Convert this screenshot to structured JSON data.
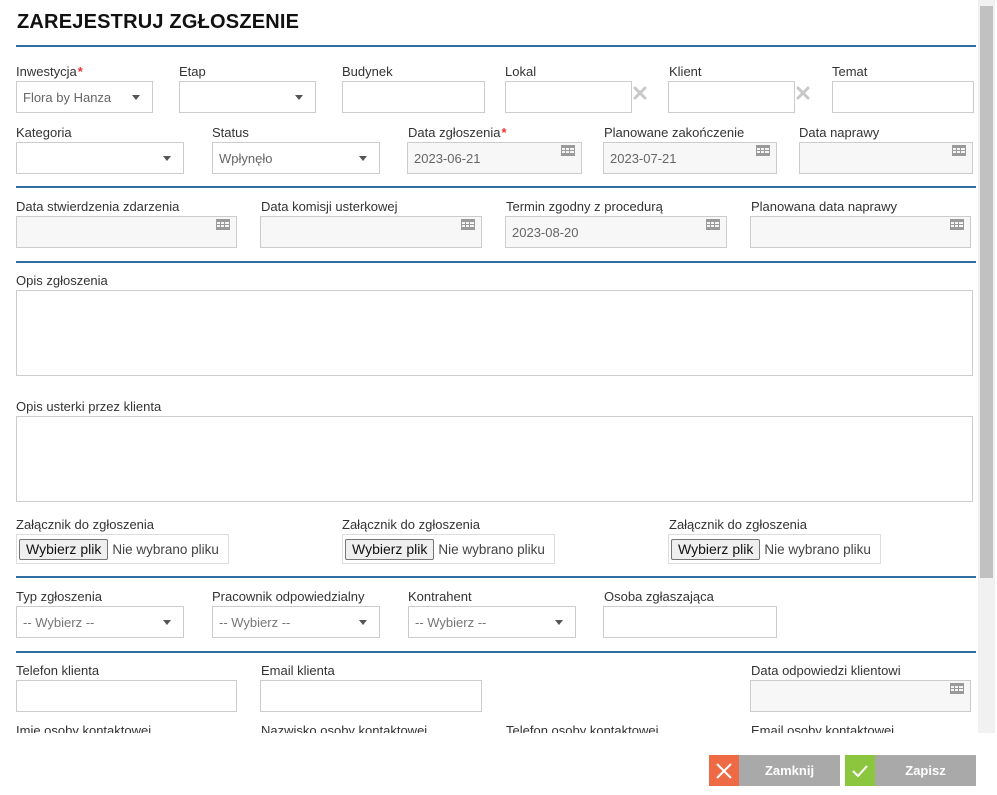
{
  "dialog": {
    "title": "ZAREJESTRUJ ZGŁOSZENIE"
  },
  "row1": {
    "inwestycja": {
      "label": "Inwestycja",
      "value": "Flora by Hanza"
    },
    "etap": {
      "label": "Etap",
      "value": ""
    },
    "budynek": {
      "label": "Budynek",
      "value": ""
    },
    "lokal": {
      "label": "Lokal",
      "value": ""
    },
    "klient": {
      "label": "Klient",
      "value": ""
    },
    "temat": {
      "label": "Temat",
      "value": ""
    }
  },
  "row2": {
    "kategoria": {
      "label": "Kategoria",
      "value": ""
    },
    "status": {
      "label": "Status",
      "value": "Wpłynęło"
    },
    "data_zgloszenia": {
      "label": "Data zgłoszenia",
      "value": "2023-06-21"
    },
    "planowane_zakonczenie": {
      "label": "Planowane zakończenie",
      "value": "2023-07-21"
    },
    "data_naprawy": {
      "label": "Data naprawy",
      "value": ""
    }
  },
  "row3": {
    "data_stwierdzenia": {
      "label": "Data stwierdzenia zdarzenia",
      "value": ""
    },
    "data_komisji": {
      "label": "Data komisji usterkowej",
      "value": ""
    },
    "termin": {
      "label": "Termin zgodny z procedurą",
      "value": "2023-08-20"
    },
    "planowana_naprawa": {
      "label": "Planowana data naprawy",
      "value": ""
    }
  },
  "opis": {
    "label": "Opis zgłoszenia",
    "value": ""
  },
  "opis_klienta": {
    "label": "Opis usterki przez klienta",
    "value": ""
  },
  "attachments": [
    {
      "label": "Załącznik do zgłoszenia",
      "button": "Wybierz plik",
      "status": "Nie wybrano pliku"
    },
    {
      "label": "Załącznik do zgłoszenia",
      "button": "Wybierz plik",
      "status": "Nie wybrano pliku"
    },
    {
      "label": "Załącznik do zgłoszenia",
      "button": "Wybierz plik",
      "status": "Nie wybrano pliku"
    }
  ],
  "row5": {
    "typ": {
      "label": "Typ zgłoszenia",
      "value": "-- Wybierz --"
    },
    "pracownik": {
      "label": "Pracownik odpowiedzialny",
      "value": "-- Wybierz --"
    },
    "kontrahent": {
      "label": "Kontrahent",
      "value": "-- Wybierz --"
    },
    "osoba": {
      "label": "Osoba zgłaszająca",
      "value": ""
    }
  },
  "row6": {
    "telefon": {
      "label": "Telefon klienta",
      "value": ""
    },
    "email": {
      "label": "Email klienta",
      "value": ""
    },
    "data_odpowiedzi": {
      "label": "Data odpowiedzi klientowi",
      "value": ""
    }
  },
  "row7": {
    "imie": {
      "label": "Imię osoby kontaktowej"
    },
    "nazwisko": {
      "label": "Nazwisko osoby kontaktowej"
    },
    "telefon_kontakt": {
      "label": "Telefon osoby kontaktowej"
    },
    "email_kontakt": {
      "label": "Email osoby kontaktowej"
    }
  },
  "footer": {
    "close_label": "Zamknij",
    "save_label": "Zapisz"
  },
  "colors": {
    "accent": "#2f6f9f",
    "required": "#ee3333",
    "close": "#ee6a45",
    "save": "#8cc63e",
    "button_gray": "#a9a9a9"
  },
  "icons": {
    "dropdown": "chevron-down-icon",
    "date": "calendar-icon",
    "clear": "close-icon",
    "close": "close-icon",
    "save": "check-icon"
  }
}
